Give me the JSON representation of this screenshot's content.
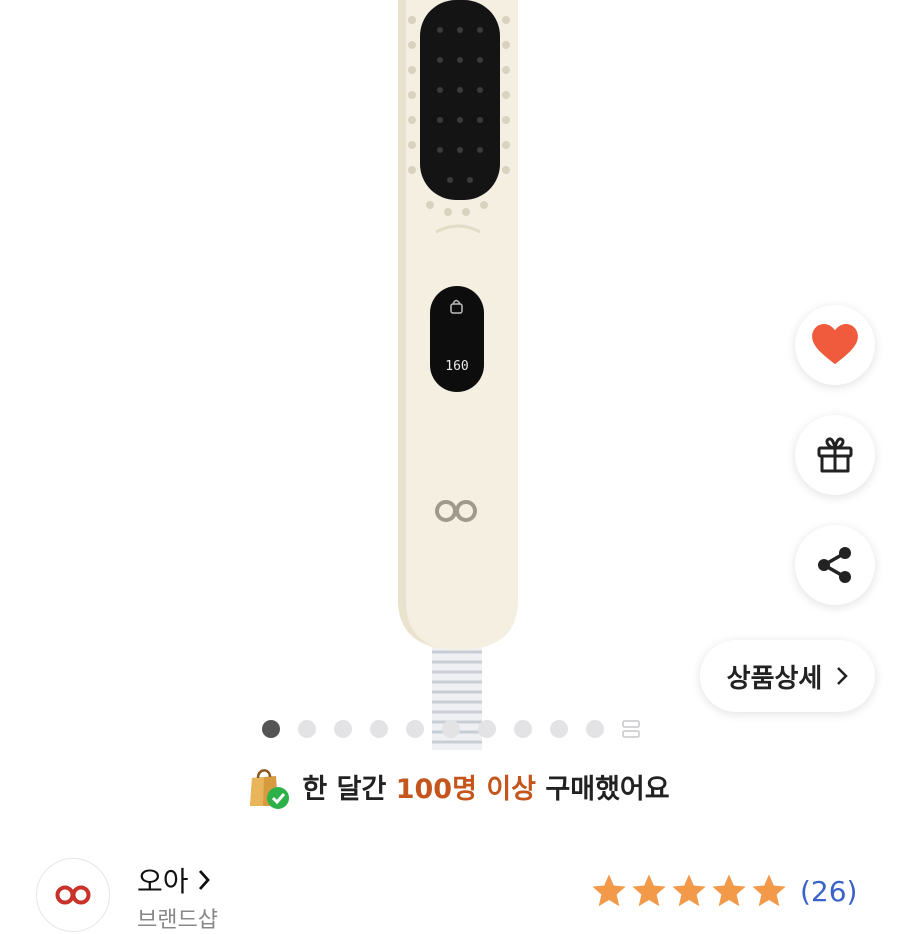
{
  "product_image": {
    "display_temp": "160"
  },
  "side_actions": {
    "like_icon": "heart-icon",
    "gift_icon": "gift-icon",
    "share_icon": "share-icon",
    "detail_label": "상품상세"
  },
  "carousel": {
    "total_dots": 10,
    "active_index": 0
  },
  "purchase_banner": {
    "prefix": "한 달간",
    "highlight": "100명 이상",
    "suffix": "구매했어요"
  },
  "seller": {
    "name": "오아",
    "subtitle": "브랜드샵",
    "rating": 5,
    "review_count": "(26)"
  },
  "colors": {
    "accent": "#c4561d",
    "heart": "#ef5b3c",
    "star": "#f29a4a",
    "link": "#3a63c9"
  }
}
